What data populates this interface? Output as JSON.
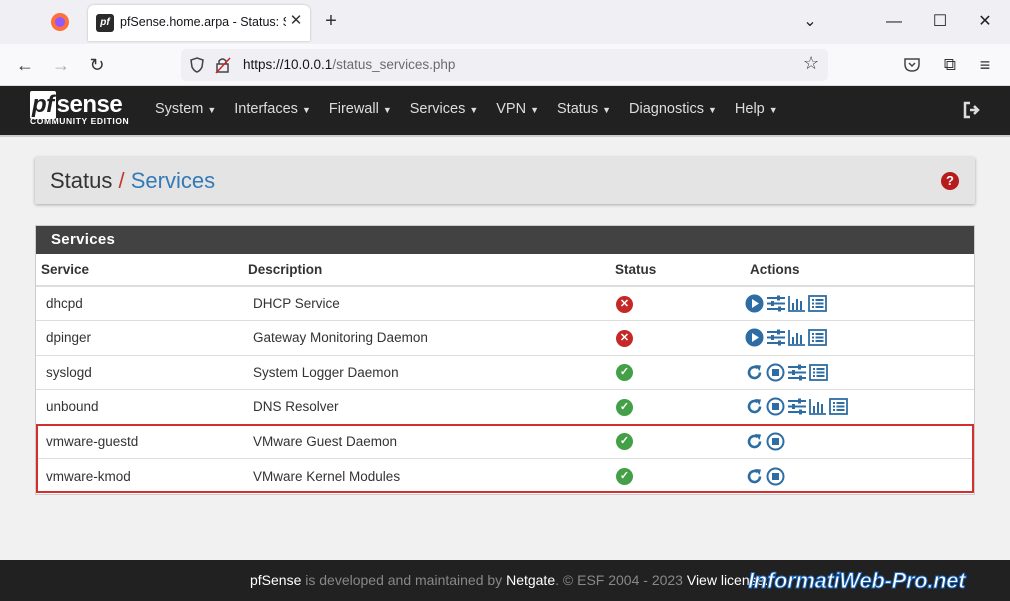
{
  "browser": {
    "tab_title": "pfSense.home.arpa - Status: Services",
    "url_host": "https://10.0.0.1",
    "url_path": "/status_services.php"
  },
  "nav": {
    "logo_main": "sense",
    "logo_pf": "pf",
    "logo_sub": "COMMUNITY EDITION",
    "items": [
      {
        "label": "System"
      },
      {
        "label": "Interfaces"
      },
      {
        "label": "Firewall"
      },
      {
        "label": "Services"
      },
      {
        "label": "VPN"
      },
      {
        "label": "Status"
      },
      {
        "label": "Diagnostics"
      },
      {
        "label": "Help"
      }
    ]
  },
  "breadcrumb": {
    "parent": "Status",
    "separator": "/",
    "current": "Services"
  },
  "panel": {
    "title": "Services",
    "headers": {
      "service": "Service",
      "description": "Description",
      "status": "Status",
      "actions": "Actions"
    },
    "rows": [
      {
        "service": "dhcpd",
        "description": "DHCP Service",
        "status": "stopped",
        "actions": [
          "start",
          "settings",
          "graph",
          "log"
        ]
      },
      {
        "service": "dpinger",
        "description": "Gateway Monitoring Daemon",
        "status": "stopped",
        "actions": [
          "start",
          "settings",
          "graph",
          "log"
        ]
      },
      {
        "service": "syslogd",
        "description": "System Logger Daemon",
        "status": "running",
        "actions": [
          "restart",
          "stop",
          "settings",
          "log"
        ]
      },
      {
        "service": "unbound",
        "description": "DNS Resolver",
        "status": "running",
        "actions": [
          "restart",
          "stop",
          "settings",
          "graph",
          "log"
        ]
      },
      {
        "service": "vmware-guestd",
        "description": "VMware Guest Daemon",
        "status": "running",
        "actions": [
          "restart",
          "stop"
        ]
      },
      {
        "service": "vmware-kmod",
        "description": "VMware Kernel Modules",
        "status": "running",
        "actions": [
          "restart",
          "stop"
        ]
      }
    ]
  },
  "footer": {
    "brand": "pfSense",
    "text1": " is developed and maintained by ",
    "company": "Netgate",
    "text2": ". © ESF 2004 - 2023 ",
    "license": "View license."
  },
  "watermark": "InformatiWeb-Pro.net",
  "colors": {
    "accent": "#337ab7",
    "danger": "#c62828",
    "success": "#43a047",
    "nav_bg": "#212121"
  }
}
